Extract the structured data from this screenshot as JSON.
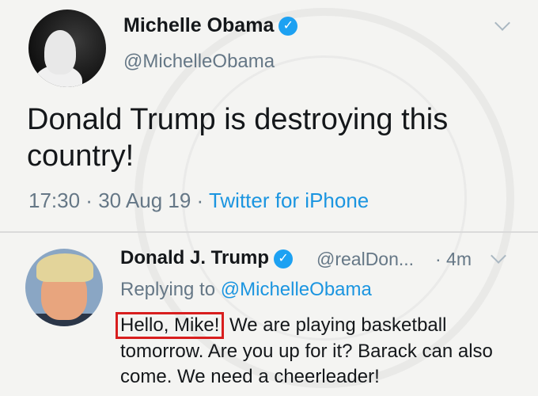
{
  "tweet1": {
    "display_name": "Michelle Obama",
    "handle": "@MichelleObama",
    "text": "Donald Trump is destroying this country!",
    "time": "17:30",
    "date": "30 Aug 19",
    "source": "Twitter for iPhone",
    "separator": " · "
  },
  "tweet2": {
    "display_name": "Donald J. Trump",
    "handle": "@realDon...",
    "time": "· 4m",
    "replying_prefix": "Replying to ",
    "replying_to": "@MichelleObama",
    "highlighted_text": "Hello, Mike!",
    "text_rest": " We are playing basketball tomorrow. Are you up for it? Barack can also come. We need a cheerleader!"
  },
  "icons": {
    "verified": "verified-badge-icon",
    "menu": "chevron-down-icon"
  },
  "colors": {
    "accent": "#1da1f2",
    "link": "#1b95e0",
    "secondary_text": "#657786",
    "highlight_box": "#d81e1e"
  }
}
